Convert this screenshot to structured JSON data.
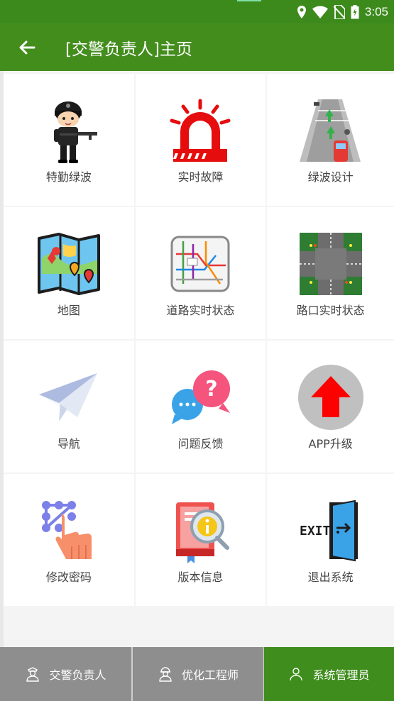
{
  "status_bar": {
    "time": "3:05",
    "icons": [
      "location-icon",
      "wifi-icon",
      "no-sim-icon",
      "battery-icon"
    ]
  },
  "header": {
    "title": "[交警负责人]主页",
    "back_icon": "arrow-left-icon"
  },
  "colors": {
    "primary": "#438d1d",
    "tab_inactive": "#8e8e8e",
    "tab_active": "#3f8d1d"
  },
  "menu": [
    {
      "label": "特勤绿波",
      "icon": "police-officer-icon"
    },
    {
      "label": "实时故障",
      "icon": "alarm-siren-icon"
    },
    {
      "label": "绿波设计",
      "icon": "road-traffic-icon"
    },
    {
      "label": "地图",
      "icon": "map-icon"
    },
    {
      "label": "道路实时状态",
      "icon": "road-status-map-icon"
    },
    {
      "label": "路口实时状态",
      "icon": "intersection-icon"
    },
    {
      "label": "导航",
      "icon": "paper-plane-icon"
    },
    {
      "label": "问题反馈",
      "icon": "feedback-bubbles-icon"
    },
    {
      "label": "APP升级",
      "icon": "upgrade-arrow-icon"
    },
    {
      "label": "修改密码",
      "icon": "pattern-lock-icon"
    },
    {
      "label": "版本信息",
      "icon": "book-info-icon"
    },
    {
      "label": "退出系统",
      "icon": "exit-door-icon"
    }
  ],
  "tabs": [
    {
      "label": "交警负责人",
      "icon": "police-user-icon",
      "active": false
    },
    {
      "label": "优化工程师",
      "icon": "engineer-user-icon",
      "active": false
    },
    {
      "label": "系统管理员",
      "icon": "admin-user-icon",
      "active": true
    }
  ]
}
